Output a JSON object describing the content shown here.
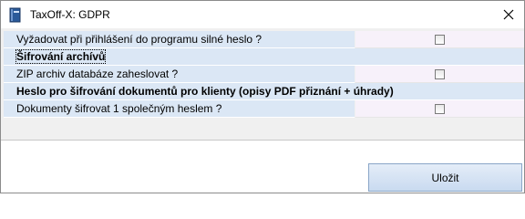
{
  "window": {
    "title": "TaxOff-X: GDPR"
  },
  "settings": {
    "rows": [
      {
        "type": "option",
        "label": "Vyžadovat při přihlášení do programu silné heslo ?",
        "checked": false
      },
      {
        "type": "section",
        "label": "Šifrování archívů"
      },
      {
        "type": "option",
        "label": "ZIP archiv databáze zaheslovat ?",
        "checked": false
      },
      {
        "type": "section",
        "label": "Heslo pro šifrování dokumentů pro klienty (opisy PDF přiznání + úhrady)"
      },
      {
        "type": "option",
        "label": "Dokumenty šifrovat 1 společným heslem ?",
        "checked": false
      }
    ]
  },
  "footer": {
    "save_label": "Uložit"
  },
  "colors": {
    "label_bg": "#dbe7f5",
    "value_bg": "#f7f1fa",
    "button_bg": "#c9daf0"
  },
  "icons": {
    "app": "book-icon",
    "close": "close-icon"
  }
}
